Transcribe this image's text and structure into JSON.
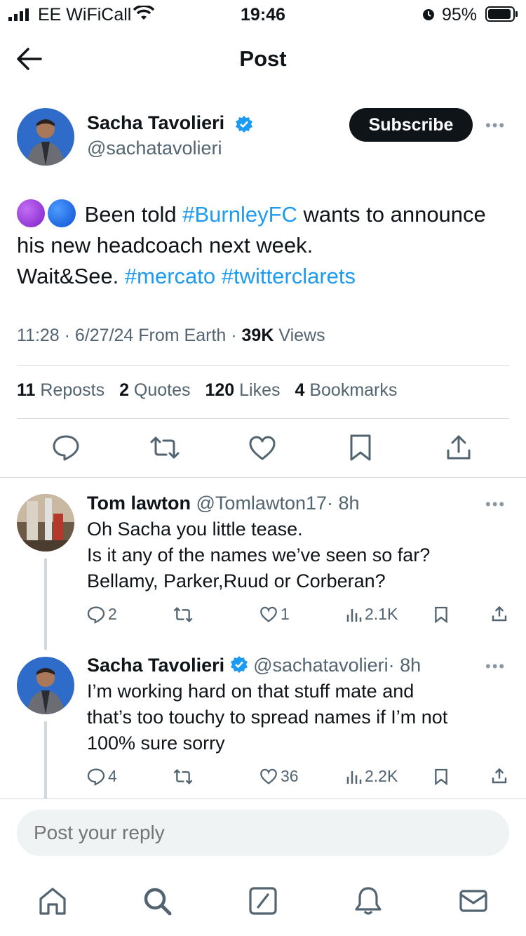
{
  "status_bar": {
    "carrier": "EE WiFiCall",
    "time": "19:46",
    "battery": "95%"
  },
  "header": {
    "title": "Post"
  },
  "post": {
    "author_name": "Sacha Tavolieri",
    "author_handle": "@sachatavolieri",
    "subscribe_label": "Subscribe",
    "text_part1": "Been told ",
    "hashtag1": "#BurnleyFC",
    "text_part2": " wants to announce his new headcoach next week.",
    "text_part3": "Wait&See. ",
    "hashtag2": "#mercato",
    "hashtag3": "#twitterclarets",
    "timestamp": "11:28 · 6/27/24 From Earth · ",
    "views_count": "39K",
    "views_label": " Views",
    "reposts_count": "11",
    "reposts_label": "Reposts",
    "quotes_count": "2",
    "quotes_label": "Quotes",
    "likes_count": "120",
    "likes_label": "Likes",
    "bookmarks_count": "4",
    "bookmarks_label": "Bookmarks"
  },
  "replies": [
    {
      "name": "Tom lawton",
      "handle": "@Tomlawton17",
      "time": "· 8h",
      "lines": [
        "Oh Sacha you little tease.",
        "Is it any of the names we’ve seen so far?",
        "Bellamy, Parker,Ruud or Corberan?"
      ],
      "reply_count": "2",
      "like_count": "1",
      "view_count": "2.1K"
    },
    {
      "name": "Sacha Tavolieri",
      "handle": "@sachatavolieri",
      "time": "· 8h",
      "lines": [
        "I’m working hard on that stuff mate and",
        "that’s too touchy to spread names if I’m not",
        "100% sure sorry"
      ],
      "reply_count": "4",
      "like_count": "36",
      "view_count": "2.2K"
    }
  ],
  "reply_box": {
    "placeholder": "Post your reply"
  },
  "colors": {
    "accent": "#1d9bf0",
    "verified": "#1d9bf0",
    "muted": "#536471"
  }
}
